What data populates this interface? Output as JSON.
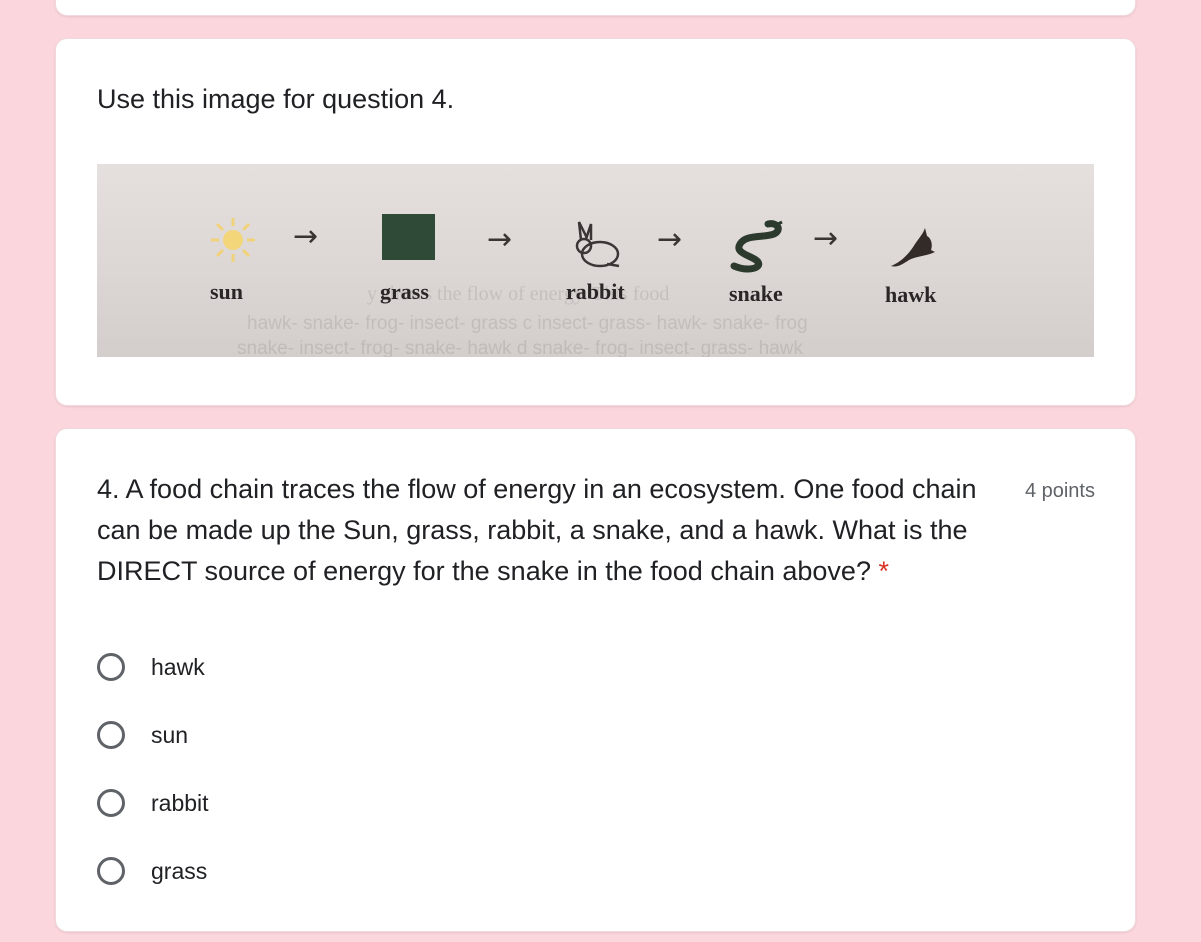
{
  "image_card": {
    "heading": "Use this image for question 4.",
    "figure": {
      "labels": {
        "sun": "sun",
        "grass": "grass",
        "rabbit": "rabbit",
        "snake": "snake",
        "hawk": "hawk"
      },
      "arrow": "→",
      "faded_text": {
        "line1": "y shows the flow of energy. This food",
        "line2": "hawk- snake- frog- insect- grass     c  insect- grass- hawk- snake- frog",
        "line3": "snake- insect- frog- snake- hawk    d  snake- frog- insect- grass- hawk"
      },
      "icons": [
        "sun-icon",
        "grass-icon",
        "rabbit-icon",
        "snake-icon",
        "hawk-icon"
      ]
    }
  },
  "question": {
    "text": "4. A food chain traces the flow of energy in an ecosystem. One food chain can be made up the Sun, grass, rabbit, a snake, and a hawk. What is the DIRECT source of energy for the snake in the food chain above?",
    "required_marker": "*",
    "points": "4 points",
    "options": [
      {
        "label": "hawk"
      },
      {
        "label": "sun"
      },
      {
        "label": "rabbit"
      },
      {
        "label": "grass"
      }
    ]
  }
}
